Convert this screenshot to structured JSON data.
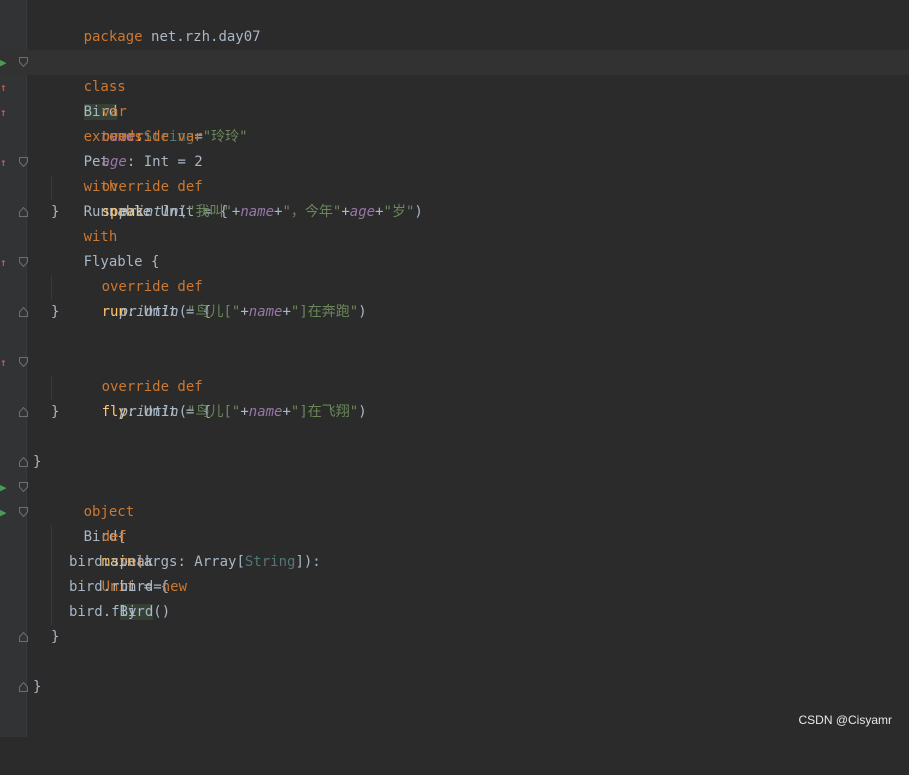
{
  "watermark": "CSDN @Cisyamr",
  "code": {
    "package": {
      "kw": "package",
      "name": " net.rzh.day07"
    },
    "class_decl": {
      "kw_class": "class",
      "name": "Bird",
      "kw_extends": "extends",
      "parent": "Pet",
      "kw_with1": "with",
      "trait1": "Runnable",
      "kw_with2": "with",
      "trait2": "Flyable",
      "brace": " {"
    },
    "var_name": {
      "kw": "var",
      "name": "name",
      "colon": ":",
      "type": "String",
      "eq": "=",
      "value": "\"玲玲\""
    },
    "var_age": {
      "kw": "override var",
      "name": "age",
      "rest": ": Int = 2"
    },
    "speak": {
      "kw": "override def",
      "name": "speak",
      "rest": ": Unit = {",
      "call": "println",
      "open": "(",
      "s1": "\"我叫\"",
      "plus": "+",
      "field": "name",
      "s2": "\"，今年\"",
      "field2": "age",
      "s3": "\"岁\"",
      "close": ")"
    },
    "run": {
      "kw": "override def",
      "name": "run",
      "rest": ": Unit = {",
      "call": "println",
      "open": "(",
      "s1": "\"鸟儿[\"",
      "plus": "+",
      "field": "name",
      "s2": "\"]在奔跑\"",
      "close": ")"
    },
    "fly": {
      "kw": "override def",
      "name": "fly",
      "rest": ": Unit = {",
      "call": "println",
      "open": "(",
      "s1": "\"鸟儿[\"",
      "plus": "+",
      "field": "name",
      "s2": "\"]在飞翔\"",
      "close": ")"
    },
    "close_brace": "}",
    "object_decl": {
      "kw": "object",
      "name": "Bird{"
    },
    "main": {
      "kw": "def",
      "name": "main",
      "p1": "(args: Array[",
      "type": "String",
      "p2": "]):",
      "ret": "Unit",
      "rest": " = {"
    },
    "val_bird": {
      "kw": "val",
      "mid": "bird=",
      "kw_new": "new",
      "cls": "Bird",
      "end": "()"
    },
    "calls": [
      "bird.speak",
      "bird.run",
      "bird.fly"
    ]
  }
}
